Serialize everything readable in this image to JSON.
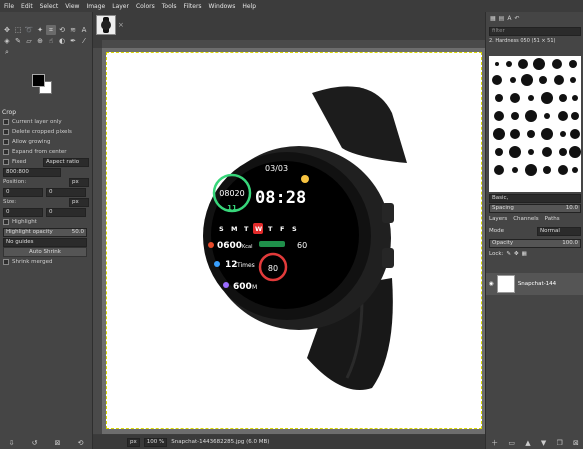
{
  "menu": [
    "File",
    "Edit",
    "Select",
    "View",
    "Image",
    "Layer",
    "Colors",
    "Tools",
    "Filters",
    "Windows",
    "Help"
  ],
  "tool_options": {
    "title": "Crop",
    "current_layer_only": "Current layer only",
    "delete_cropped": "Delete cropped pixels",
    "allow_growing": "Allow growing",
    "expand_from_center": "Expand from center",
    "fixed": "Fixed",
    "aspect_ratio": "Aspect ratio",
    "ratio_value": "800:800",
    "position_label": "Position:",
    "position_unit": "px",
    "position_x": "0",
    "position_y": "0",
    "size_label": "Size:",
    "size_unit": "px",
    "size_x": "0",
    "size_y": "0",
    "highlight": "Highlight",
    "highlight_opacity_label": "Highlight opacity",
    "highlight_opacity_value": "50.0",
    "guides": "No guides",
    "auto_shrink": "Auto Shrink",
    "shrink_merged": "Shrink merged"
  },
  "watch_face": {
    "date": "03/03",
    "steps": "08020",
    "time": "08:28",
    "days": [
      "S",
      "M",
      "T",
      "W",
      "T",
      "F",
      "S"
    ],
    "kcal": "0600",
    "kcal_unit": "Kcal",
    "battery": "60",
    "times_value": "12",
    "times_unit": "Times",
    "heart_rate": "80",
    "distance": "600",
    "distance_unit": "M",
    "day_counter": "11"
  },
  "status": {
    "unit": "px",
    "zoom": "100 %",
    "file": "Snapchat-1443682285.jpg (6.0 MB)"
  },
  "dock": {
    "brush_name": "2. Hardness 050 (51 × 51)",
    "filter_placeholder": "filter",
    "brush_preset": "Basic,",
    "spacing_label": "Spacing",
    "spacing_value": "10.0",
    "tabs": [
      "Layers",
      "Channels",
      "Paths"
    ],
    "mode_label": "Mode",
    "mode_value": "Normal",
    "opacity_label": "Opacity",
    "opacity_value": "100.0",
    "lock_label": "Lock:",
    "layer_name": "Snapchat-144"
  }
}
